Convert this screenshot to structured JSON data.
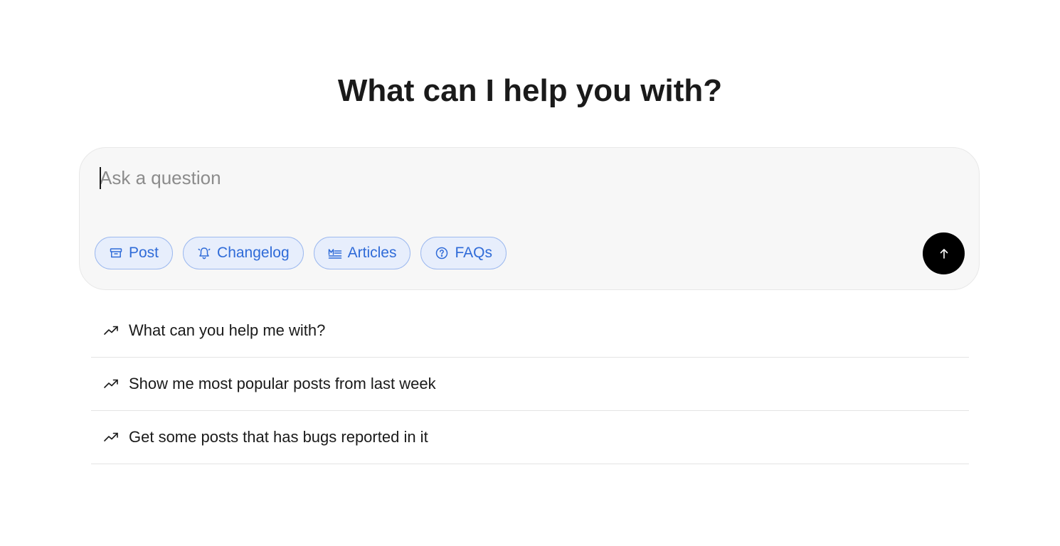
{
  "heading": "What can I help you with?",
  "composer": {
    "placeholder": "Ask a question",
    "value": "",
    "chips": [
      {
        "label": "Post",
        "icon": "archive-box-icon"
      },
      {
        "label": "Changelog",
        "icon": "bell-icon"
      },
      {
        "label": "Articles",
        "icon": "markdown-article-icon"
      },
      {
        "label": "FAQs",
        "icon": "question-circle-icon"
      }
    ],
    "send_icon": "arrow-up-icon"
  },
  "suggestions": [
    {
      "text": "What can you help me with?",
      "icon": "trending-up-icon"
    },
    {
      "text": "Show me most popular posts from last week",
      "icon": "trending-up-icon"
    },
    {
      "text": "Get some posts that has bugs reported in it",
      "icon": "trending-up-icon"
    }
  ],
  "colors": {
    "chip_text": "#2f6bd8",
    "chip_bg": "#e7eefc",
    "chip_border": "#9db9ef",
    "send_bg": "#000000",
    "composer_bg": "#f7f7f7"
  }
}
